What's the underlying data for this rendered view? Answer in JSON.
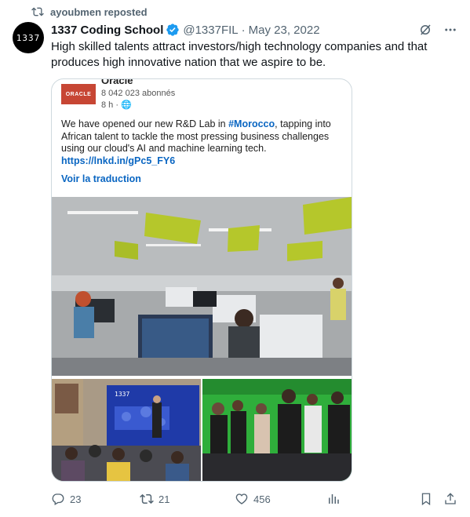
{
  "repost": {
    "label": "ayoubmen reposted",
    "icon": "repost-icon"
  },
  "author": {
    "avatar_text": "1337",
    "name": "1337 Coding School",
    "handle": "@1337FIL",
    "separator": "·",
    "date": "May 23, 2022",
    "verified_color": "#1d9bf0"
  },
  "tweet": {
    "text": "High skilled talents attract investors/high technology companies and that produces high innovative nation that we aspire to be."
  },
  "card": {
    "org_logo_text": "ORACLE",
    "org_name": "Oracle",
    "followers": "8 042 023 abonnés",
    "time": "8 h · 🌐",
    "body_before": "We have opened our new R&D Lab in ",
    "hashtag": "#Morocco",
    "body_after": ", tapping into African talent to tackle the most pressing business challenges using our cloud's AI and machine learning tech.",
    "link": "https://lnkd.in/gPc5_FY6",
    "translate": "Voir la traduction",
    "screen_text": "1337",
    "link_color": "#0a66c2",
    "oracle_red": "#c74634"
  },
  "actions": {
    "replies": "23",
    "reposts": "21",
    "likes": "456"
  }
}
